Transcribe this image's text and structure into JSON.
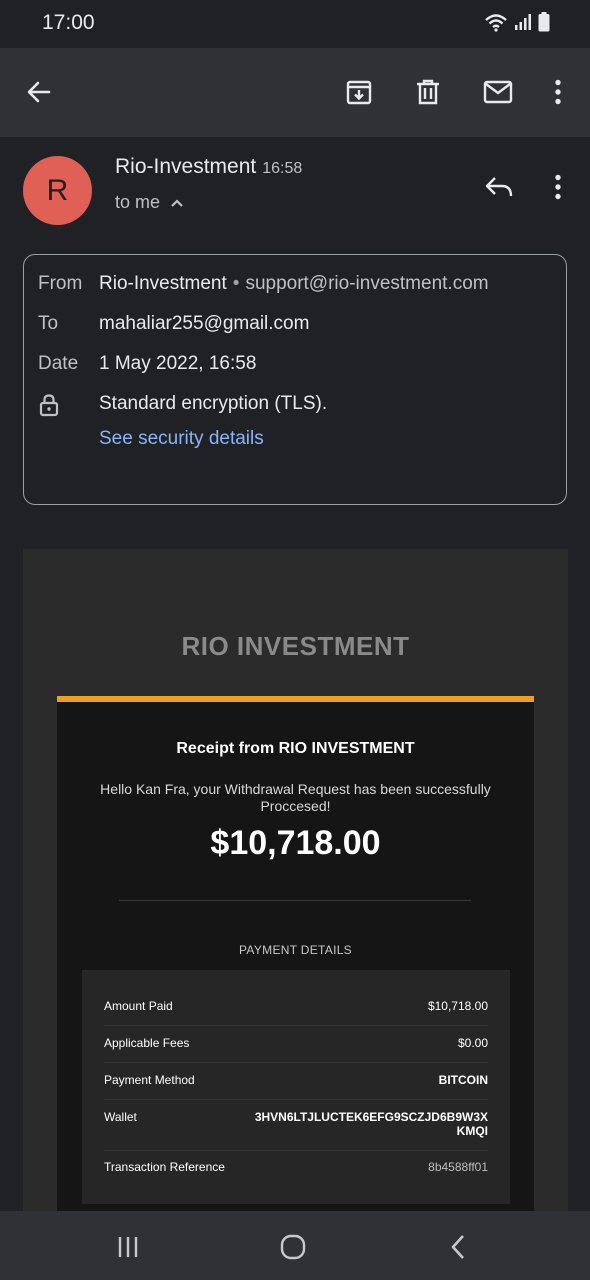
{
  "status_bar": {
    "time": "17:00",
    "icons": [
      "wifi-icon",
      "signal-icon",
      "battery-icon"
    ]
  },
  "app_bar": {
    "actions": [
      "back-icon",
      "archive-icon",
      "delete-icon",
      "mark-unread-icon",
      "more-icon"
    ]
  },
  "email_header": {
    "avatar_letter": "R",
    "avatar_color": "#e06055",
    "sender": "Rio-Investment",
    "time": "16:58",
    "recipient_summary": "to me"
  },
  "details": {
    "from_label": "From",
    "from_name": "Rio-Investment",
    "from_separator": "•",
    "from_email": "support@rio-investment.com",
    "to_label": "To",
    "to_value": "mahaliar255@gmail.com",
    "date_label": "Date",
    "date_value": "1 May 2022, 16:58",
    "encryption": "Standard encryption (TLS).",
    "security_link": "See security details"
  },
  "message": {
    "brand": "RIO INVESTMENT",
    "accent_color": "#f0a020",
    "receipt_title": "Receipt from RIO INVESTMENT",
    "greeting": "Hello Kan Fra, your Withdrawal Request has been successfully Proccesed!",
    "amount": "$10,718.00",
    "payment_details_title": "PAYMENT DETAILS",
    "rows": [
      {
        "label": "Amount Paid",
        "value": "$10,718.00"
      },
      {
        "label": "Applicable Fees",
        "value": "$0.00"
      },
      {
        "label": "Payment Method",
        "value": "BITCOIN"
      },
      {
        "label": "Wallet",
        "value_line1": "3HVN6LTJLUCTEK6EFG9SCZJD6B9W3X",
        "value_line2": "KMQI"
      },
      {
        "label": "Transaction Reference",
        "value": "8b4588ff01"
      }
    ]
  },
  "nav_bar": {
    "buttons": [
      "recent-apps-icon",
      "home-icon",
      "back-nav-icon"
    ]
  }
}
